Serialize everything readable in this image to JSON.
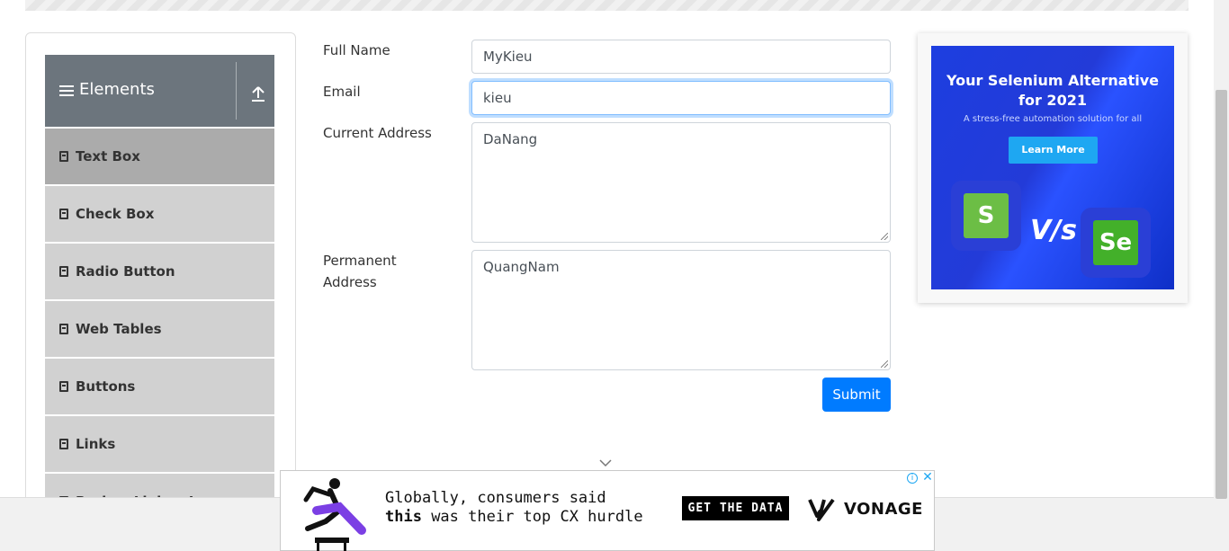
{
  "sidebar": {
    "group_title": "Elements",
    "items": [
      {
        "label": "Text Box",
        "active": true
      },
      {
        "label": "Check Box"
      },
      {
        "label": "Radio Button"
      },
      {
        "label": "Web Tables"
      },
      {
        "label": "Buttons"
      },
      {
        "label": "Links"
      },
      {
        "label": "Broken Links - Images"
      }
    ]
  },
  "form": {
    "full_name": {
      "label": "Full Name",
      "value": "MyKieu"
    },
    "email": {
      "label": "Email",
      "value": "kieu"
    },
    "current_address": {
      "label": "Current Address",
      "value": "DaNang"
    },
    "permanent_address": {
      "label_line1": "Permanent",
      "label_line2": "Address",
      "value": "QuangNam"
    },
    "submit_label": "Submit"
  },
  "side_ad": {
    "headline_line1": "Your Selenium Alternative",
    "headline_line2": "for 2021",
    "subtitle": "A stress-free automation solution for all",
    "cta": "Learn More",
    "vs_text": "V/s",
    "left_logo": "S",
    "right_logo": "Se"
  },
  "bottom_ad": {
    "line1": "Globally, consumers said",
    "line2_bold": "this",
    "line2_rest": " was their top CX hurdle",
    "cta": "GET THE DATA",
    "brand": "VONAGE",
    "info": "i",
    "close": "✕"
  },
  "colors": {
    "primary": "#007bff",
    "sidebar_header": "#6c757d",
    "menu_bg": "#d1d1d1",
    "menu_active_bg": "#ababab",
    "ad_blue": "#233bd8"
  }
}
